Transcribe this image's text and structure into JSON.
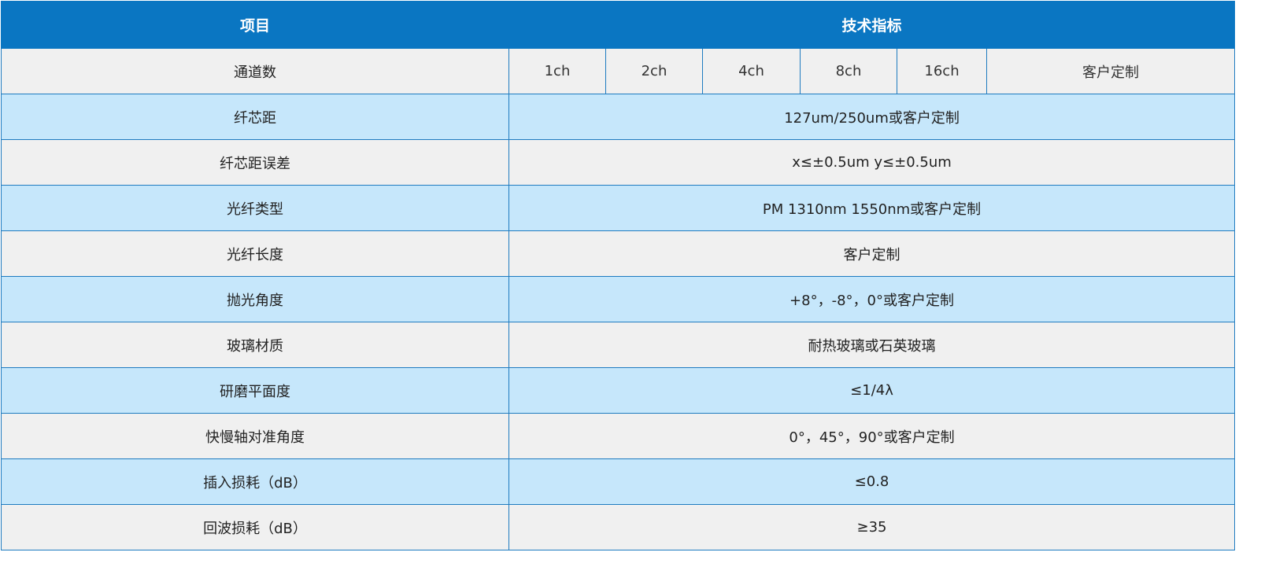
{
  "header": {
    "item_label": "项目",
    "spec_label": "技术指标"
  },
  "channels": {
    "label": "通道数",
    "options": [
      "1ch",
      "2ch",
      "4ch",
      "8ch",
      "16ch",
      "客户定制"
    ]
  },
  "rows": [
    {
      "label": "纤芯距",
      "value": "127um/250um或客户定制"
    },
    {
      "label": "纤芯距误差",
      "value": "x≤±0.5um y≤±0.5um"
    },
    {
      "label": "光纤类型",
      "value": "PM 1310nm 1550nm或客户定制"
    },
    {
      "label": "光纤长度",
      "value": "客户定制"
    },
    {
      "label": "抛光角度",
      "value": "+8°，-8°，0°或客户定制"
    },
    {
      "label": "玻璃材质",
      "value": "耐热玻璃或石英玻璃"
    },
    {
      "label": "研磨平面度",
      "value": "≤1/4λ"
    },
    {
      "label": "快慢轴对准角度",
      "value": "0°，45°，90°或客户定制"
    },
    {
      "label": "插入损耗（dB）",
      "value": "≤0.8"
    },
    {
      "label": "回波损耗（dB）",
      "value": "≥35"
    }
  ],
  "colors": {
    "header_bg": "#0a76c2",
    "border": "#1e7bc0",
    "row_gray": "#f0f0f0",
    "row_blue": "#c6e7fb"
  }
}
